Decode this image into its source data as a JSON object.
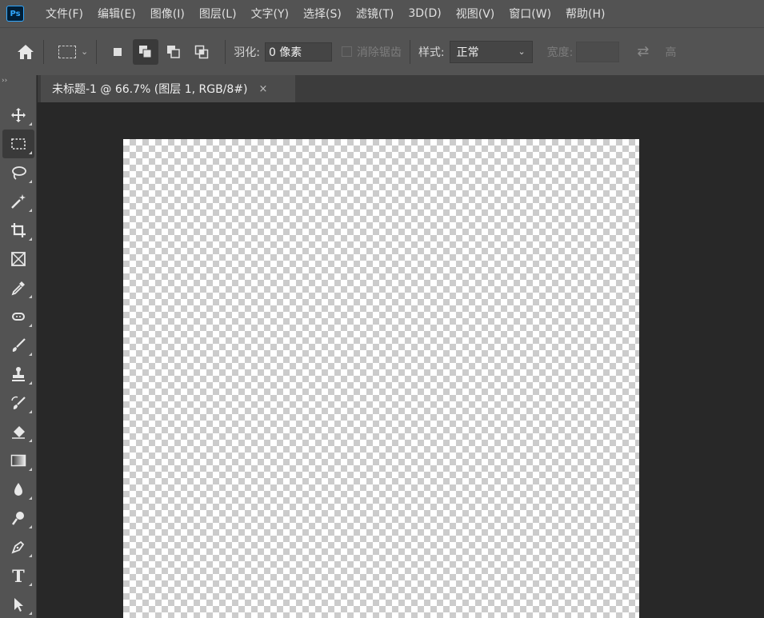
{
  "app": {
    "logo_text": "Ps"
  },
  "menu": [
    "文件(F)",
    "编辑(E)",
    "图像(I)",
    "图层(L)",
    "文字(Y)",
    "选择(S)",
    "滤镜(T)",
    "3D(D)",
    "视图(V)",
    "窗口(W)",
    "帮助(H)"
  ],
  "options": {
    "feather_label": "羽化:",
    "feather_value": "0 像素",
    "antialias_label": "消除锯齿",
    "style_label": "样式:",
    "style_value": "正常",
    "width_label": "宽度:",
    "height_label": "高"
  },
  "document": {
    "tab_title": "未标题-1 @ 66.7% (图层 1, RGB/8#)",
    "close_glyph": "×"
  },
  "tools": [
    {
      "name": "move-tool-icon"
    },
    {
      "name": "marquee-tool-icon"
    },
    {
      "name": "lasso-tool-icon"
    },
    {
      "name": "magic-wand-tool-icon"
    },
    {
      "name": "crop-tool-icon"
    },
    {
      "name": "frame-tool-icon"
    },
    {
      "name": "eyedropper-tool-icon"
    },
    {
      "name": "healing-brush-tool-icon"
    },
    {
      "name": "brush-tool-icon"
    },
    {
      "name": "clone-stamp-tool-icon"
    },
    {
      "name": "history-brush-tool-icon"
    },
    {
      "name": "eraser-tool-icon"
    },
    {
      "name": "gradient-tool-icon"
    },
    {
      "name": "blur-tool-icon"
    },
    {
      "name": "dodge-tool-icon"
    },
    {
      "name": "pen-tool-icon"
    },
    {
      "name": "type-tool-icon"
    },
    {
      "name": "path-selection-tool-icon"
    }
  ],
  "type_tool_glyph": "T",
  "colors": {
    "ui_panel": "#535353",
    "workspace": "#282828",
    "accent": "#31a8ff"
  }
}
